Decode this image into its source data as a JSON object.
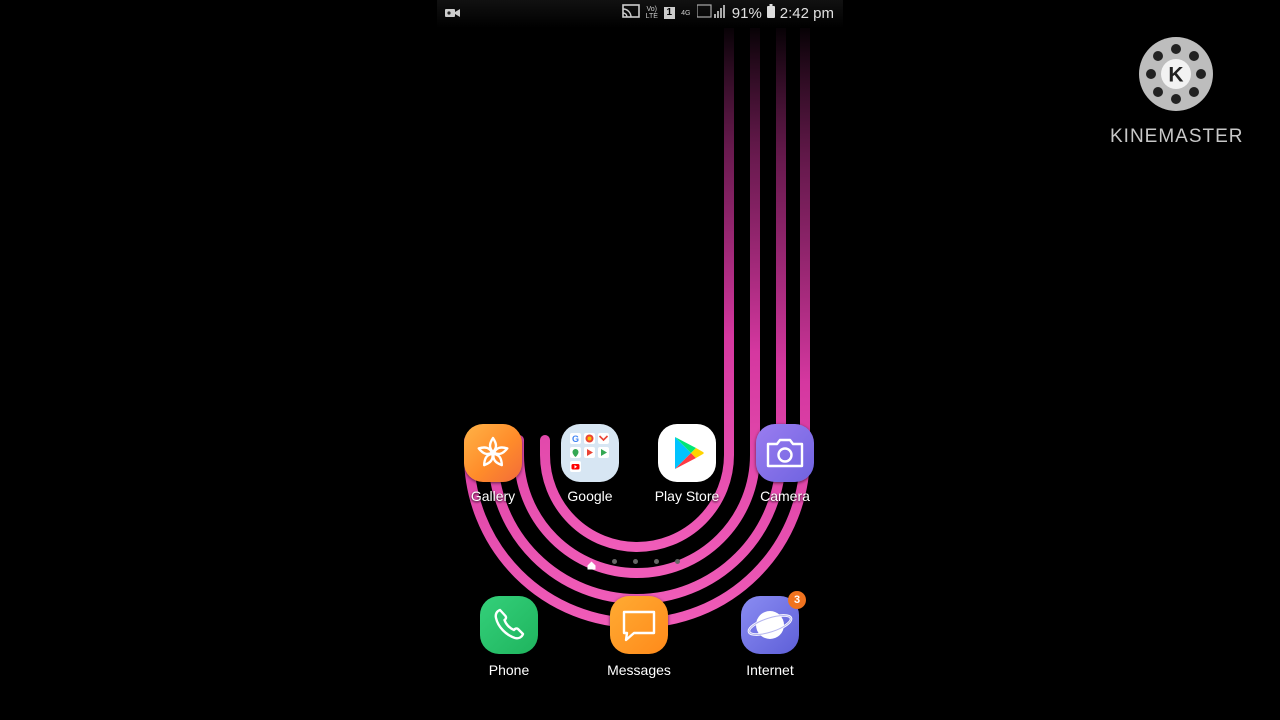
{
  "status_bar": {
    "carrier_badge_1": "Vo) LTE",
    "sim_badge": "1",
    "network_type": "4G",
    "battery_percent": "91%",
    "time": "2:42 pm"
  },
  "home": {
    "apps": [
      {
        "label": "Gallery",
        "icon": "gallery-icon"
      },
      {
        "label": "Google",
        "icon": "google-folder-icon"
      },
      {
        "label": "Play Store",
        "icon": "play-store-icon"
      },
      {
        "label": "Camera",
        "icon": "camera-icon"
      }
    ],
    "page_indicator": {
      "pages": 5,
      "current": 1
    }
  },
  "dock": {
    "apps": [
      {
        "label": "Phone",
        "icon": "phone-icon"
      },
      {
        "label": "Messages",
        "icon": "messages-icon"
      },
      {
        "label": "Internet",
        "icon": "internet-icon",
        "badge": "3"
      }
    ]
  },
  "watermark": {
    "text": "KINEMASTER",
    "letter": "K"
  },
  "colors": {
    "wallpaper_stripe": "#e03aa8",
    "badge": "#f0731f"
  }
}
